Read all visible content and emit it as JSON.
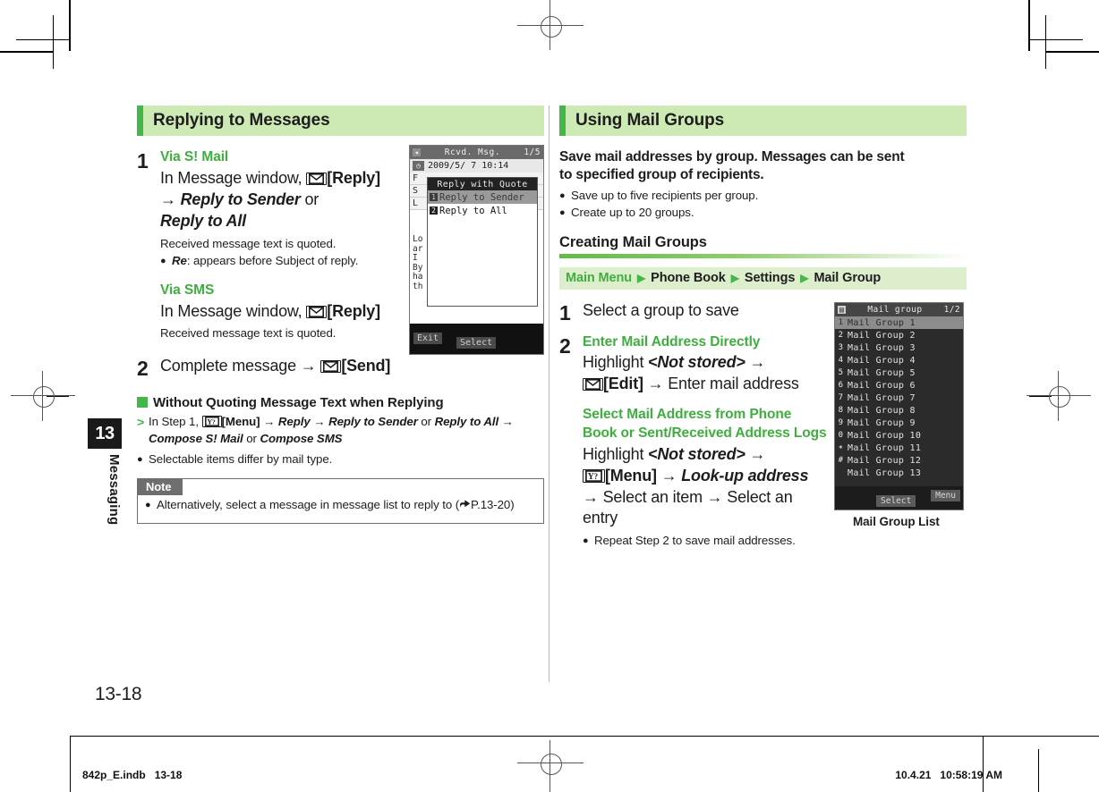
{
  "chapter": {
    "number": "13",
    "name": "Messaging"
  },
  "page": {
    "number": "13-18"
  },
  "footer": {
    "left": "842p_E.indb   13-18",
    "right": "10.4.21   10:58:19 AM"
  },
  "left_column": {
    "header": "Replying to Messages",
    "step1": {
      "num": "1",
      "heading_smail": "Via S! Mail",
      "line1_pre": "In Message window, ",
      "line1_key": "mail-key",
      "line1_post": "[Reply]",
      "line2_arrow": "→",
      "line2_italic": "Reply to Sender",
      "line2_or": " or",
      "line3_italic": "Reply to All",
      "note1": "Received message text is quoted.",
      "bullet1_italic": "Re",
      "bullet1_rest": ": appears before Subject of reply.",
      "heading_sms": "Via SMS",
      "sms_line_pre": "In Message window, ",
      "sms_line_post": "[Reply]",
      "sms_note": "Received message text is quoted."
    },
    "step2": {
      "num": "2",
      "text_pre": "Complete message ",
      "arrow": "→",
      "text_post": "[Send]"
    },
    "subblock": {
      "title": "Without Quoting Message Text when Replying",
      "gt": ">",
      "line_a_pre": "In Step 1, ",
      "line_a_key_label": "[Menu]",
      "line_a_arrow1": "→",
      "line_a_it1": "Reply",
      "line_a_arrow2": "→",
      "line_a_it2": "Reply to Sender",
      "line_a_or": " or ",
      "line_a_it3": "Reply to All",
      "line_a_arrow3": "→",
      "line_b_it1": "Compose S! Mail",
      "line_b_or": " or ",
      "line_b_it2": "Compose SMS",
      "bullet": "Selectable items differ by mail type."
    },
    "note": {
      "tab": "Note",
      "text_pre": "Alternatively, select a message in message list to reply to (",
      "ref": "P.13-20",
      "text_post": ")"
    }
  },
  "right_column": {
    "header": "Using Mail Groups",
    "intro": "Save mail addresses by group. Messages can be sent to specified group of recipients.",
    "intro_bullets": [
      "Save up to five recipients per group.",
      "Create up to 20 groups."
    ],
    "sub_header": "Creating Mail Groups",
    "nav_path": [
      "Main Menu",
      "Phone Book",
      "Settings",
      "Mail Group"
    ],
    "nav_arrow": "▶",
    "step1": {
      "num": "1",
      "text": "Select a group to save"
    },
    "step2": {
      "num": "2",
      "heading_a": "Enter Mail Address Directly",
      "a_line1_pre": "Highlight ",
      "a_line1_italic": "<Not stored>",
      "a_line1_arrow": "→",
      "a_line2_label": "[Edit]",
      "a_line2_arrow": "→",
      "a_line2_post": " Enter mail address",
      "heading_b_l1": "Select Mail Address from Phone",
      "heading_b_l2": "Book or Sent/Received Address Logs",
      "b_line1_pre": "Highlight ",
      "b_line1_italic": "<Not stored>",
      "b_line1_arrow": "→",
      "b_line2_label": "[Menu]",
      "b_line2_arrow": "→",
      "b_line2_italic": "Look-up address",
      "b_line3_arrow1": "→",
      "b_line3_t1": " Select an item ",
      "b_line3_arrow2": "→",
      "b_line3_t2": " Select an entry",
      "bullet": "Repeat Step 2 to save mail addresses."
    }
  },
  "screenshot_reply": {
    "caption": "",
    "title": "Rcvd. Msg.",
    "counter": "1/5",
    "date": "2009/5/ 7 10:14",
    "bg_rows": [
      "F",
      "S",
      "L"
    ],
    "bg_body": [
      "Lo",
      "ar",
      "I",
      "By",
      "ha",
      "th"
    ],
    "popup_title": "Reply with Quote",
    "items": [
      {
        "num": "1",
        "label": "Reply to Sender",
        "selected": true
      },
      {
        "num": "2",
        "label": "Reply to All",
        "selected": false
      }
    ],
    "softkey_left": "Exit",
    "softkey_center": "Select"
  },
  "screenshot_group": {
    "caption": "Mail Group List",
    "title": "Mail group",
    "counter": "1/2",
    "rows": [
      {
        "key": "1",
        "label": "Mail Group 1",
        "selected": true
      },
      {
        "key": "2",
        "label": "Mail Group 2",
        "selected": false
      },
      {
        "key": "3",
        "label": "Mail Group 3",
        "selected": false
      },
      {
        "key": "4",
        "label": "Mail Group 4",
        "selected": false
      },
      {
        "key": "5",
        "label": "Mail Group 5",
        "selected": false
      },
      {
        "key": "6",
        "label": "Mail Group 6",
        "selected": false
      },
      {
        "key": "7",
        "label": "Mail Group 7",
        "selected": false
      },
      {
        "key": "8",
        "label": "Mail Group 8",
        "selected": false
      },
      {
        "key": "9",
        "label": "Mail Group 9",
        "selected": false
      },
      {
        "key": "0",
        "label": "Mail Group 10",
        "selected": false
      },
      {
        "key": "∗",
        "label": "Mail Group 11",
        "selected": false
      },
      {
        "key": "#",
        "label": "Mail Group 12",
        "selected": false
      },
      {
        "key": "",
        "label": "Mail Group 13",
        "selected": false
      }
    ],
    "softkey_center": "Select",
    "softkey_right": "Menu"
  },
  "colors": {
    "accent_green": "#45b649",
    "header_bg": "#cde9b4",
    "nav_bg": "#ddeecd",
    "text_green": "#3fae3f"
  }
}
